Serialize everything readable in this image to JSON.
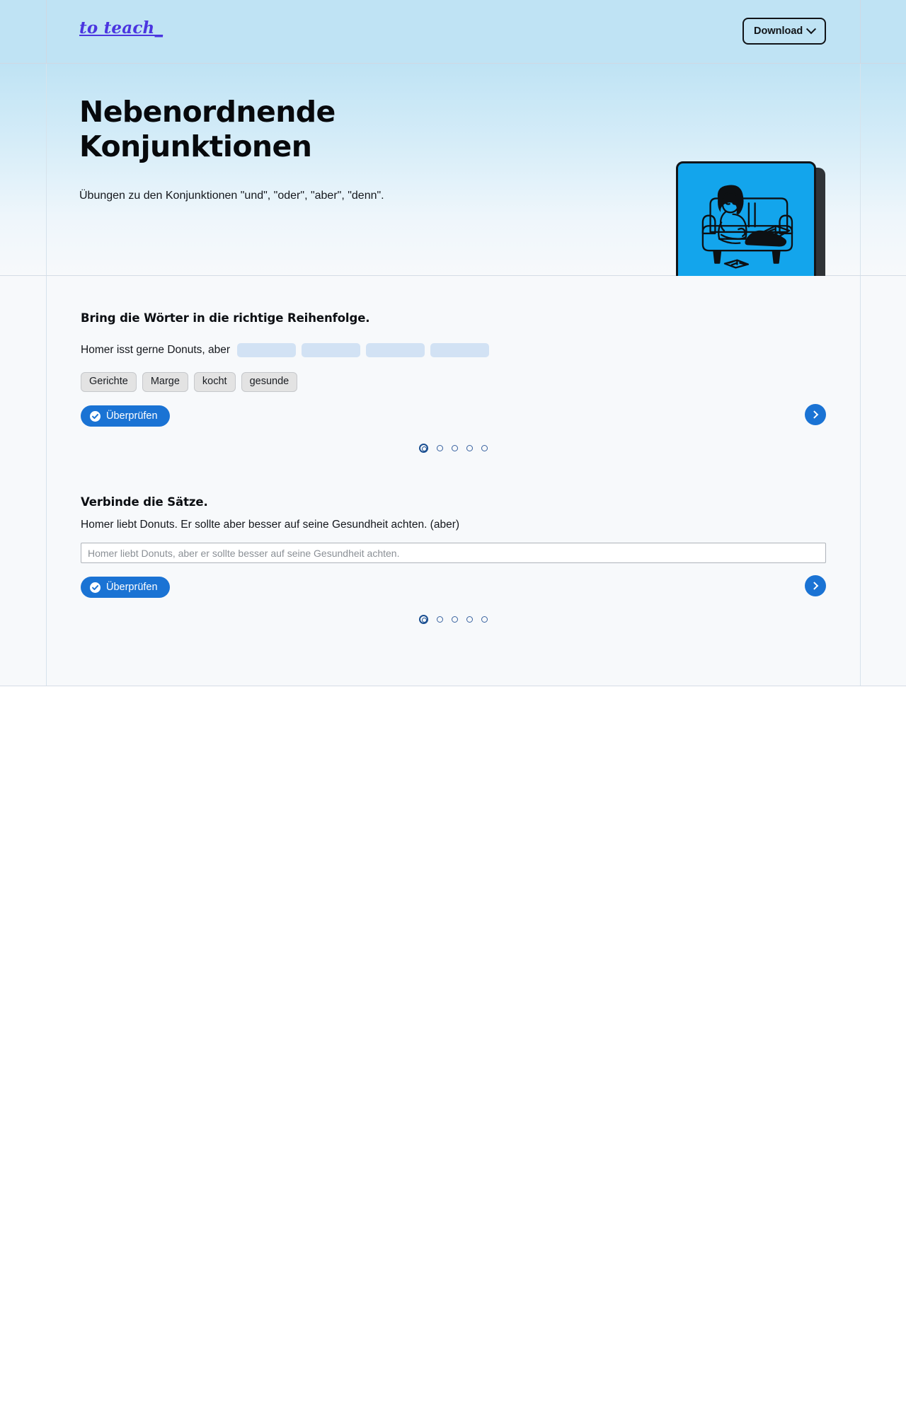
{
  "header": {
    "logo_text": "to teach_",
    "download_label": "Download",
    "download_icon": "chevron-down-icon"
  },
  "hero": {
    "title": "Nebenordnende Konjunktionen",
    "subtitle": "Übungen zu den Konjunktionen \"und\", \"oder\", \"aber\", \"denn\".",
    "illustration_alt": "woman-reading-on-couch-illustration",
    "illustration_bg": "#13a5ec",
    "illustration_border": "#111418"
  },
  "colors": {
    "accent_blue": "#1a73d4",
    "header_bg": "#bfe3f4",
    "content_bg": "#f7f9fb",
    "dropzone_blue": "#d2e2f4",
    "logo_purple": "#4b35e0"
  },
  "exercises": [
    {
      "id": "word-order",
      "title": "Bring die Wörter in die richtige Reihenfolge.",
      "sentence_prefix": "Homer isst gerne Donuts, aber",
      "dropzone_count": 4,
      "word_bank": [
        "Gerichte",
        "Marge",
        "kocht",
        "gesunde"
      ],
      "check_label": "Überprüfen",
      "check_icon": "check-circle-icon",
      "next_icon": "chevron-right-icon",
      "pagination": {
        "total": 5,
        "active": 1
      }
    },
    {
      "id": "connect-sentences",
      "title": "Verbinde die Sätze.",
      "prompt": "Homer liebt Donuts. Er sollte aber besser auf seine Gesundheit achten. (aber)",
      "input_placeholder": "Homer liebt Donuts, aber er sollte besser auf seine Gesundheit achten.",
      "input_value": "",
      "check_label": "Überprüfen",
      "check_icon": "check-circle-icon",
      "next_icon": "chevron-right-icon",
      "pagination": {
        "total": 5,
        "active": 1
      }
    }
  ]
}
